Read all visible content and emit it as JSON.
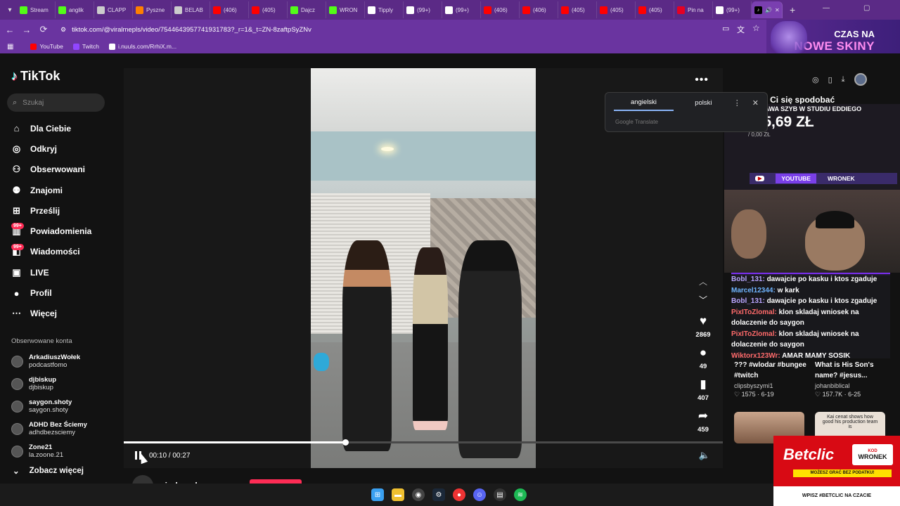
{
  "browser": {
    "tabs": [
      {
        "label": "Stream",
        "icon": "kick-icon",
        "color": "#53fc18"
      },
      {
        "label": "anglik",
        "icon": "kick-icon",
        "color": "#53fc18"
      },
      {
        "label": "CLAPP",
        "icon": "globe-icon",
        "color": "#cccccc"
      },
      {
        "label": "Pyszne",
        "icon": "home-icon",
        "color": "#ff8000"
      },
      {
        "label": "BELAB",
        "icon": "globe-icon",
        "color": "#cccccc"
      },
      {
        "label": "(406)",
        "icon": "youtube-icon",
        "color": "#ff0000"
      },
      {
        "label": "(405)",
        "icon": "youtube-icon",
        "color": "#ff0000"
      },
      {
        "label": "Dajcz",
        "icon": "kick-icon",
        "color": "#53fc18"
      },
      {
        "label": "WRON",
        "icon": "kick-icon",
        "color": "#53fc18"
      },
      {
        "label": "Tipply",
        "icon": "tipply-icon",
        "color": "#ffffff"
      },
      {
        "label": "(99+)",
        "icon": "tiktok-icon",
        "color": "#ffffff"
      },
      {
        "label": "(99+)",
        "icon": "tiktok-icon",
        "color": "#ffffff"
      },
      {
        "label": "(406)",
        "icon": "youtube-icon",
        "color": "#ff0000"
      },
      {
        "label": "(406)",
        "icon": "youtube-icon",
        "color": "#ff0000"
      },
      {
        "label": "(405)",
        "icon": "youtube-icon",
        "color": "#ff0000"
      },
      {
        "label": "(405)",
        "icon": "youtube-icon",
        "color": "#ff0000"
      },
      {
        "label": "(405)",
        "icon": "youtube-icon",
        "color": "#ff0000"
      },
      {
        "label": "Pin na",
        "icon": "pinterest-icon",
        "color": "#e60023"
      },
      {
        "label": "(99+)",
        "icon": "tiktok-icon",
        "color": "#ffffff"
      }
    ],
    "url": "tiktok.com/@viralmepls/video/7544643957741931783?_r=1&_t=ZN-8zaftpSyZNv",
    "bookmarks": [
      {
        "label": "YouTube",
        "color": "#ff0000"
      },
      {
        "label": "Twitch",
        "color": "#9146ff"
      },
      {
        "label": "i.nuuls.com/RrhiX.m...",
        "color": "#ffffff"
      }
    ],
    "promo": {
      "line1": "CZAS NA",
      "line2": "NOWE SKINY"
    }
  },
  "translate": {
    "tab_from": "angielski",
    "tab_to": "polski",
    "brand": "Google Translate"
  },
  "sidebar": {
    "logo": "TikTok",
    "search_placeholder": "Szukaj",
    "menu": [
      {
        "label": "Dla Ciebie",
        "icon": "home-icon"
      },
      {
        "label": "Odkryj",
        "icon": "compass-icon"
      },
      {
        "label": "Obserwowani",
        "icon": "following-icon"
      },
      {
        "label": "Znajomi",
        "icon": "friends-icon"
      },
      {
        "label": "Prześlij",
        "icon": "upload-icon"
      },
      {
        "label": "Powiadomienia",
        "icon": "inbox-icon",
        "badge": "99+"
      },
      {
        "label": "Wiadomości",
        "icon": "messages-icon",
        "badge": "99+"
      },
      {
        "label": "LIVE",
        "icon": "live-icon"
      },
      {
        "label": "Profil",
        "icon": "profile-icon"
      },
      {
        "label": "Więcej",
        "icon": "more-icon"
      }
    ],
    "following_title": "Obserwowane konta",
    "accounts": [
      {
        "name": "ArkadiuszWołek",
        "handle": "podcastfomo"
      },
      {
        "name": "djbiskup",
        "handle": "djbiskup"
      },
      {
        "name": "saygon.shoty",
        "handle": "saygon.shoty"
      },
      {
        "name": "ADHD Bez Ściemy",
        "handle": "adhdbezsciemy"
      },
      {
        "name": "Zone21",
        "handle": "la.zoone.21"
      }
    ],
    "see_more": "Zobacz więcej"
  },
  "player": {
    "current_time": "00:10",
    "duration": "00:27",
    "time_display": "00:10 / 00:27",
    "progress": 0.37,
    "likes": "2869",
    "comments": "49",
    "saves": "407",
    "shares": "459",
    "author": "viralmepls"
  },
  "right": {
    "recommend_title": "To może Ci się spodobać",
    "stream": {
      "header": "NAPRAWA SZYB W STUDIU EDDIEGO",
      "price": "995,69 ZŁ",
      "sub": "/ 0,00 ZŁ",
      "youtube": "YOUTUBE",
      "twitch": "WRONEK"
    },
    "chat": [
      {
        "user": "Bobl_131:",
        "msg": "dawajcie po kasku i ktos zgaduje",
        "cls": "u"
      },
      {
        "user": "Marcel12344:",
        "msg": "w kark",
        "cls": "u3"
      },
      {
        "user": "Bobl_131:",
        "msg": "dawajcie po kasku i ktos zgaduje",
        "cls": "u"
      },
      {
        "user": "PixIToZlomal:",
        "msg": "klon skladaj wniosek na dolaczenie do saygon",
        "cls": "u2"
      },
      {
        "user": "PixIToZlomal:",
        "msg": "klon skladaj wniosek na dolaczenie do saygon",
        "cls": "u2"
      },
      {
        "user": "Wiktorx123Wr:",
        "msg": "AMAR MAMY SOSIK",
        "cls": "u2"
      }
    ],
    "cards": [
      {
        "desc": "??? #wlodar #bungee #twitch",
        "author": "clipsbyszymi1",
        "likes": "1575",
        "date": "6-19"
      },
      {
        "desc": "What is His Son's name? #jesus...",
        "author": "johanbiblical",
        "likes": "157.7K",
        "date": "6-25"
      }
    ],
    "thumb_caption": "Kai cenat shows how good his production team is"
  },
  "betclic": {
    "brand": "Betclic",
    "kod_label": "KOD",
    "kod": "WRONEK",
    "strip": "MOŻESZ GRAĆ BEZ PODATKU!",
    "bottom": "WPISZ #BETCLIC NA CZACIE"
  }
}
